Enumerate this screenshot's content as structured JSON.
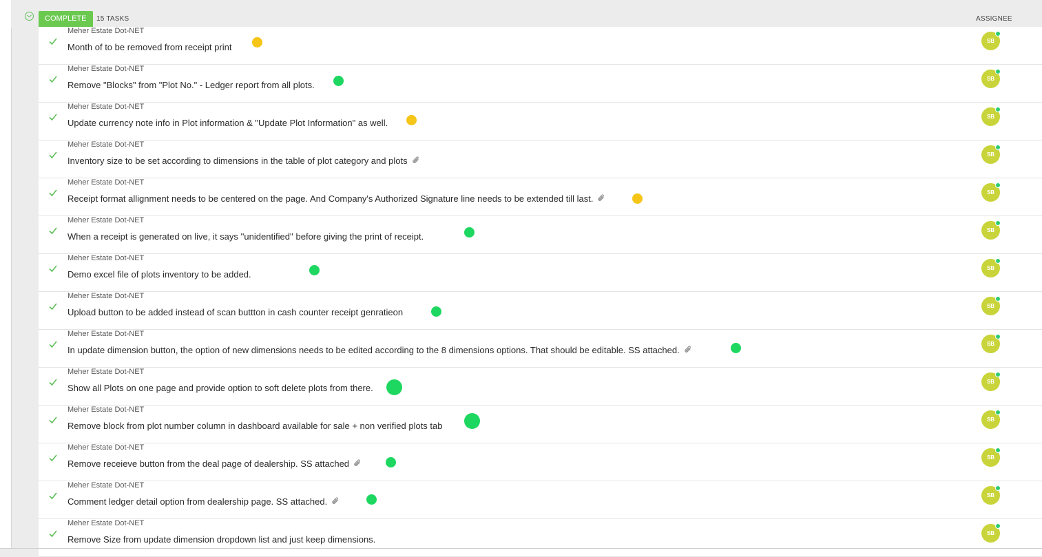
{
  "group": {
    "status_label": "COMPLETE",
    "task_count": "15 TASKS",
    "assignee_header": "ASSIGNEE",
    "status_color": "#6bc950"
  },
  "colors": {
    "check": "#5fbf5a",
    "priority_normal": "#f5c518",
    "priority_low": "#1ed760",
    "avatar": "#c9d43a"
  },
  "tasks": [
    {
      "project": "Meher Estate Dot-NET",
      "title": "Month of to be removed from receipt print",
      "attachment": false,
      "priority": "yellow",
      "assignee": "SB"
    },
    {
      "project": "Meher Estate Dot-NET",
      "title": "Remove \"Blocks\" from \"Plot No.\" - Ledger report from all plots.",
      "attachment": false,
      "priority": "green",
      "assignee": "SB"
    },
    {
      "project": "Meher Estate Dot-NET",
      "title": "Update currency note info in Plot information & \"Update Plot Information\" as well.",
      "attachment": false,
      "priority": "yellow",
      "assignee": "SB"
    },
    {
      "project": "Meher Estate Dot-NET",
      "title": "Inventory size to be set according to dimensions in the table of plot category and plots",
      "attachment": true,
      "priority": "none",
      "assignee": "SB"
    },
    {
      "project": "Meher Estate Dot-NET",
      "title": "Receipt format allignment needs to be centered on the page. And Company's Authorized Signature line needs to be extended till last.",
      "attachment": true,
      "priority": "yellow",
      "assignee": "SB"
    },
    {
      "project": "Meher Estate Dot-NET",
      "title": "When a receipt is generated on live, it says ''unidentified'' before giving the print of receipt.",
      "attachment": false,
      "priority": "green",
      "assignee": "SB"
    },
    {
      "project": "Meher Estate Dot-NET",
      "title": "Demo excel file of plots inventory to be added.",
      "attachment": false,
      "priority": "green",
      "assignee": "SB"
    },
    {
      "project": "Meher Estate Dot-NET",
      "title": "Upload button to be added instead of scan buttton in cash counter receipt genratieon",
      "attachment": false,
      "priority": "green",
      "assignee": "SB"
    },
    {
      "project": "Meher Estate Dot-NET",
      "title": "In update dimension button, the option of new dimensions needs to be edited according to the 8 dimensions options. That should be editable. SS attached.",
      "attachment": true,
      "priority": "green",
      "assignee": "SB"
    },
    {
      "project": "Meher Estate Dot-NET",
      "title": "Show all Plots on one page and provide option to soft delete plots from there.",
      "attachment": false,
      "priority": "green-large",
      "assignee": "SB"
    },
    {
      "project": "Meher Estate Dot-NET",
      "title": "Remove block from plot number column in dashboard available for sale + non verified plots tab",
      "attachment": false,
      "priority": "green-large",
      "assignee": "SB"
    },
    {
      "project": "Meher Estate Dot-NET",
      "title": "Remove receieve button from the deal page of dealership. SS attached",
      "attachment": true,
      "priority": "green",
      "assignee": "SB"
    },
    {
      "project": "Meher Estate Dot-NET",
      "title": "Comment ledger detail option from dealership page. SS attached.",
      "attachment": true,
      "priority": "green",
      "assignee": "SB"
    },
    {
      "project": "Meher Estate Dot-NET",
      "title": "Remove Size from update dimension dropdown list and just keep dimensions.",
      "attachment": false,
      "priority": "none",
      "assignee": "SB"
    }
  ]
}
